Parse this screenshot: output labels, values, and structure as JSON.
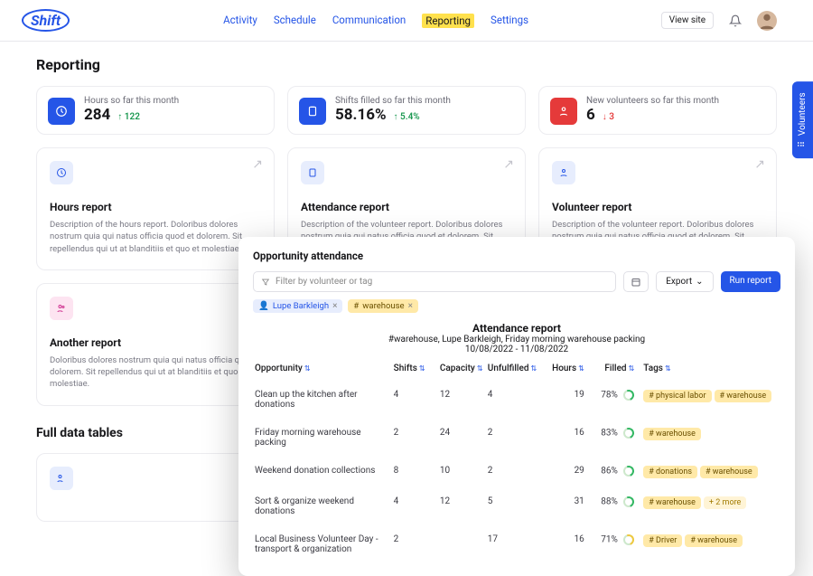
{
  "nav": {
    "activity": "Activity",
    "schedule": "Schedule",
    "communication": "Communication",
    "reporting": "Reporting",
    "settings": "Settings"
  },
  "top": {
    "view_site": "View site"
  },
  "page_title": "Reporting",
  "side_tab": "Volunteers",
  "stats": [
    {
      "label": "Hours so far this month",
      "value": "284",
      "delta": "122",
      "dir": "up"
    },
    {
      "label": "Shifts filled so far this month",
      "value": "58.16%",
      "delta": "5.4%",
      "dir": "up"
    },
    {
      "label": "New volunteers so far this month",
      "value": "6",
      "delta": "3",
      "dir": "down"
    }
  ],
  "reports": [
    {
      "title": "Hours report",
      "desc": "Description of the hours report. Doloribus dolores nostrum quia qui natus officia quod et dolorem. Sit repellendus qui ut at blanditiis et quo et molestiae."
    },
    {
      "title": "Attendance report",
      "desc": "Description of the volunteer report. Doloribus dolores nostrum quia qui natus officia quod et dolorem. Sit repellendus qui ut at blanditiis et quo et molestiae."
    },
    {
      "title": "Volunteer report",
      "desc": "Description of the volunteer report. Doloribus dolores nostrum quia qui natus officia quod et dolorem. Sit repellendus qui ut at blanditiis et quo et molestiae."
    },
    {
      "title": "Another report",
      "desc": "Doloribus dolores nostrum quia qui natus officia quod et dolorem. Sit repellendus qui ut at blanditiis et quo et molestiae."
    }
  ],
  "section2": "Full data tables",
  "modal": {
    "title": "Opportunity attendance",
    "filter_placeholder": "Filter by volunteer or tag",
    "export": "Export",
    "run": "Run report",
    "chip_person": "Lupe Barkleigh",
    "chip_tag": "warehouse",
    "header": {
      "title": "Attendance report",
      "subtitle": "#warehouse, Lupe Barkleigh, Friday morning warehouse packing",
      "dates": "10/08/2022 - 11/08/2022"
    },
    "columns": {
      "opportunity": "Opportunity",
      "shifts": "Shifts",
      "capacity": "Capacity",
      "unfulfilled": "Unfulfilled",
      "hours": "Hours",
      "filled": "Filled",
      "tags": "Tags"
    },
    "rows": [
      {
        "opp": "Clean up the kitchen after donations",
        "shifts": "4",
        "cap": "12",
        "unf": "4",
        "hours": "19",
        "filled": "78%",
        "tags": [
          "physical labor",
          "warehouse"
        ]
      },
      {
        "opp": "Friday morning warehouse packing",
        "shifts": "2",
        "cap": "24",
        "unf": "2",
        "hours": "16",
        "filled": "83%",
        "tags": [
          "warehouse"
        ]
      },
      {
        "opp": "Weekend donation collections",
        "shifts": "8",
        "cap": "10",
        "unf": "2",
        "hours": "29",
        "filled": "86%",
        "tags": [
          "donations",
          "warehouse"
        ]
      },
      {
        "opp": "Sort & organize weekend donations",
        "shifts": "4",
        "cap": "12",
        "unf": "5",
        "hours": "31",
        "filled": "88%",
        "tags": [
          "warehouse"
        ],
        "more": "+ 2 more"
      },
      {
        "opp": "Local Business Volunteer Day - transport & organization",
        "shifts": "2",
        "cap": "",
        "unf": "17",
        "hours": "16",
        "filled": "71%",
        "ring": "y",
        "tags": [
          "Driver",
          "warehouse"
        ]
      }
    ]
  }
}
